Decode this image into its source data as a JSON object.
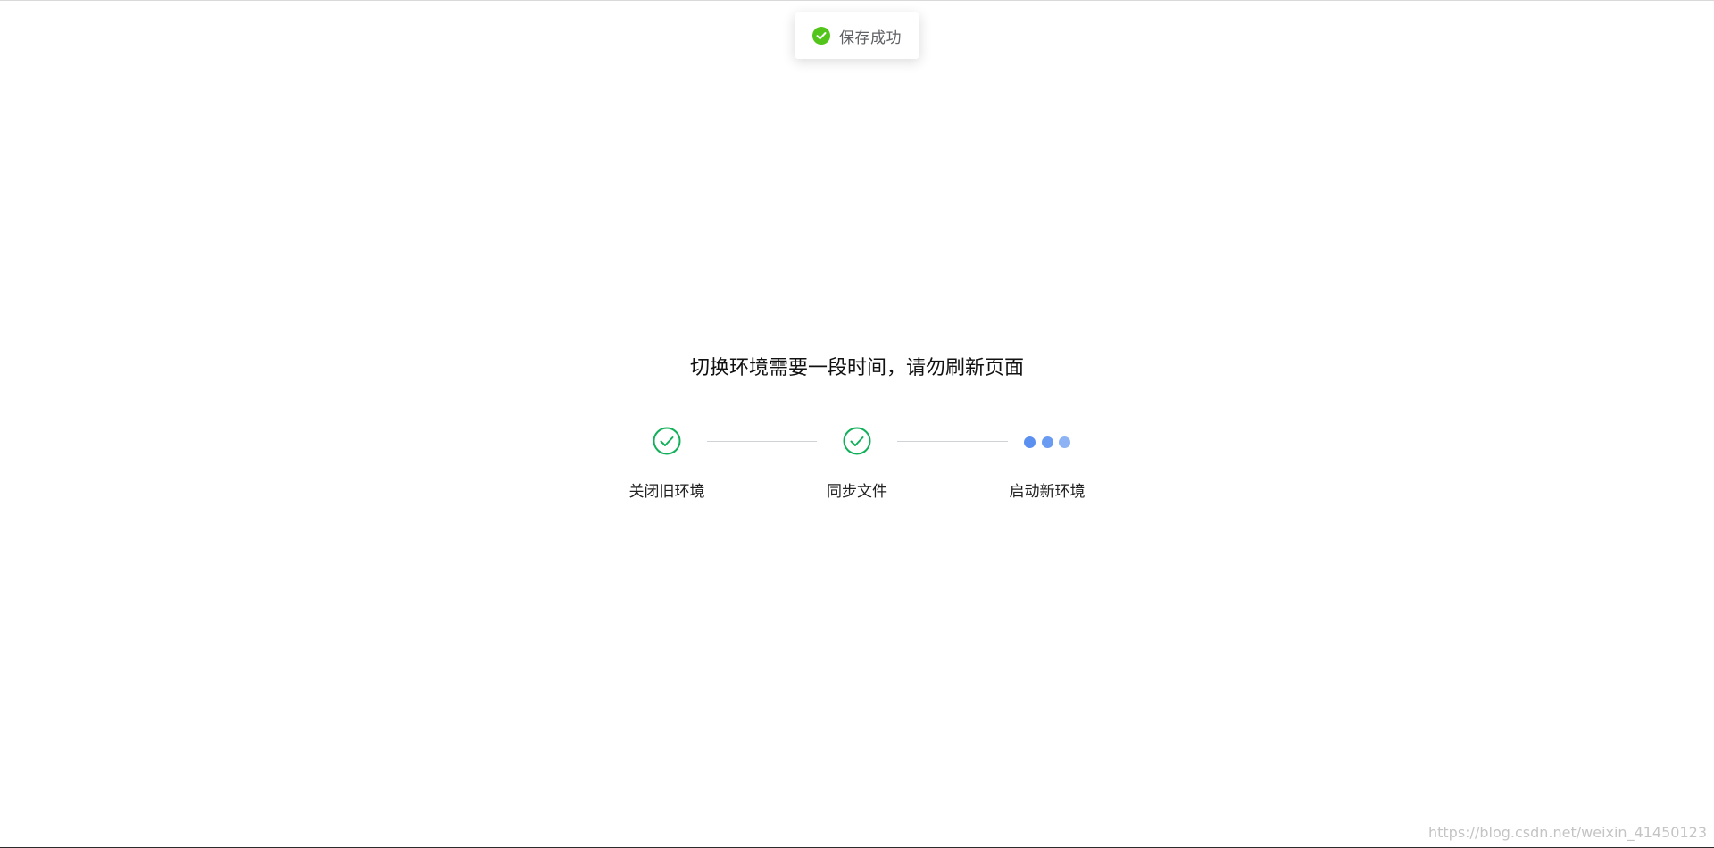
{
  "toast": {
    "icon": "success-check-icon",
    "message": "保存成功",
    "icon_color": "#52c41a"
  },
  "headline": "切换环境需要一段时间，请勿刷新页面",
  "steps": [
    {
      "label": "关闭旧环境",
      "status": "done",
      "icon": "check-circle-icon"
    },
    {
      "label": "同步文件",
      "status": "done",
      "icon": "check-circle-icon"
    },
    {
      "label": "启动新环境",
      "status": "in-progress",
      "icon": "loading-dots-icon"
    }
  ],
  "colors": {
    "done": "#12b05a",
    "loading_dots": [
      "#5b8ff0",
      "#6a9bf2",
      "#8db3f5"
    ],
    "connector": "#cfd2d6"
  },
  "watermark": "https://blog.csdn.net/weixin_41450123"
}
